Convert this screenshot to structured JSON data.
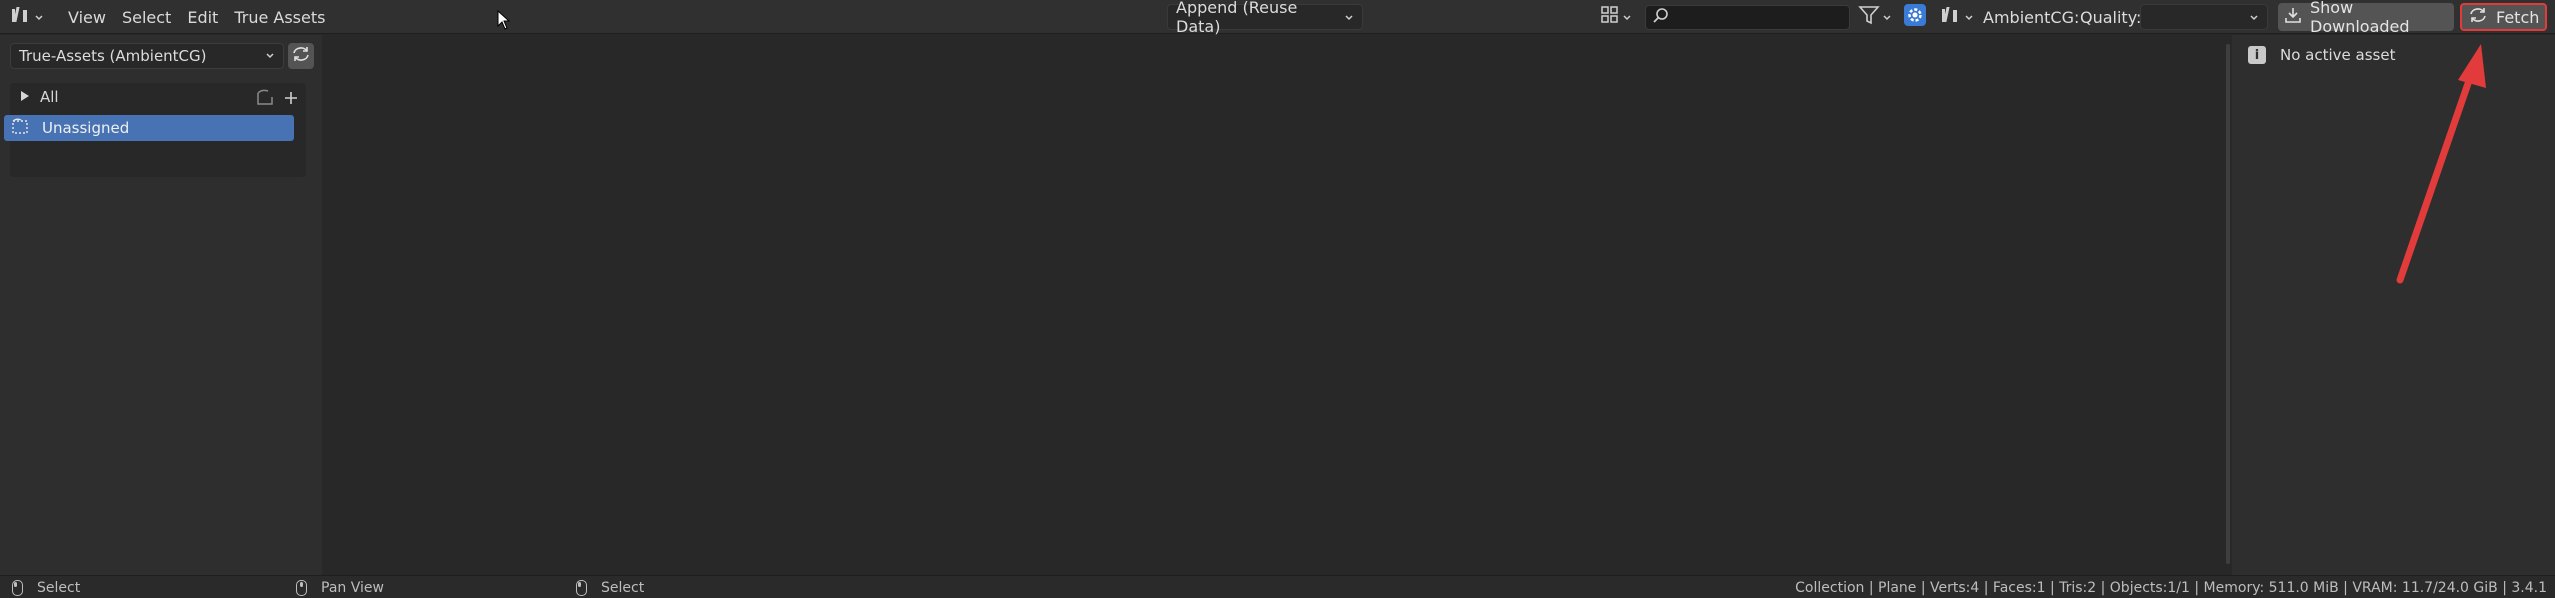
{
  "header": {
    "menus": [
      "View",
      "Select",
      "Edit",
      "True Assets"
    ],
    "import_method": "Append (Reuse Data)",
    "search": {
      "value": "",
      "placeholder": ""
    },
    "provider_label": "AmbientCG:",
    "quality_label": "Quality:",
    "quality_value": "",
    "show_downloaded_label": "Show Downloaded",
    "fetch_label": "Fetch"
  },
  "sidebar": {
    "library": "True-Assets (AmbientCG)",
    "catalog_all": "All",
    "catalog_unassigned": "Unassigned"
  },
  "right_panel": {
    "message": "No active asset"
  },
  "statusbar": {
    "left_action": "Select",
    "middle_action": "Pan View",
    "right_action": "Select",
    "info": "Collection | Plane | Verts:4 | Faces:1 | Tris:2 | Objects:1/1 | Memory: 511.0 MiB | VRAM: 11.7/24.0 GiB | 3.4.1"
  },
  "colors": {
    "accent_selected": "#4772b3",
    "annotation_red": "#e23b3b",
    "gear_blue": "#3a7bd5"
  }
}
